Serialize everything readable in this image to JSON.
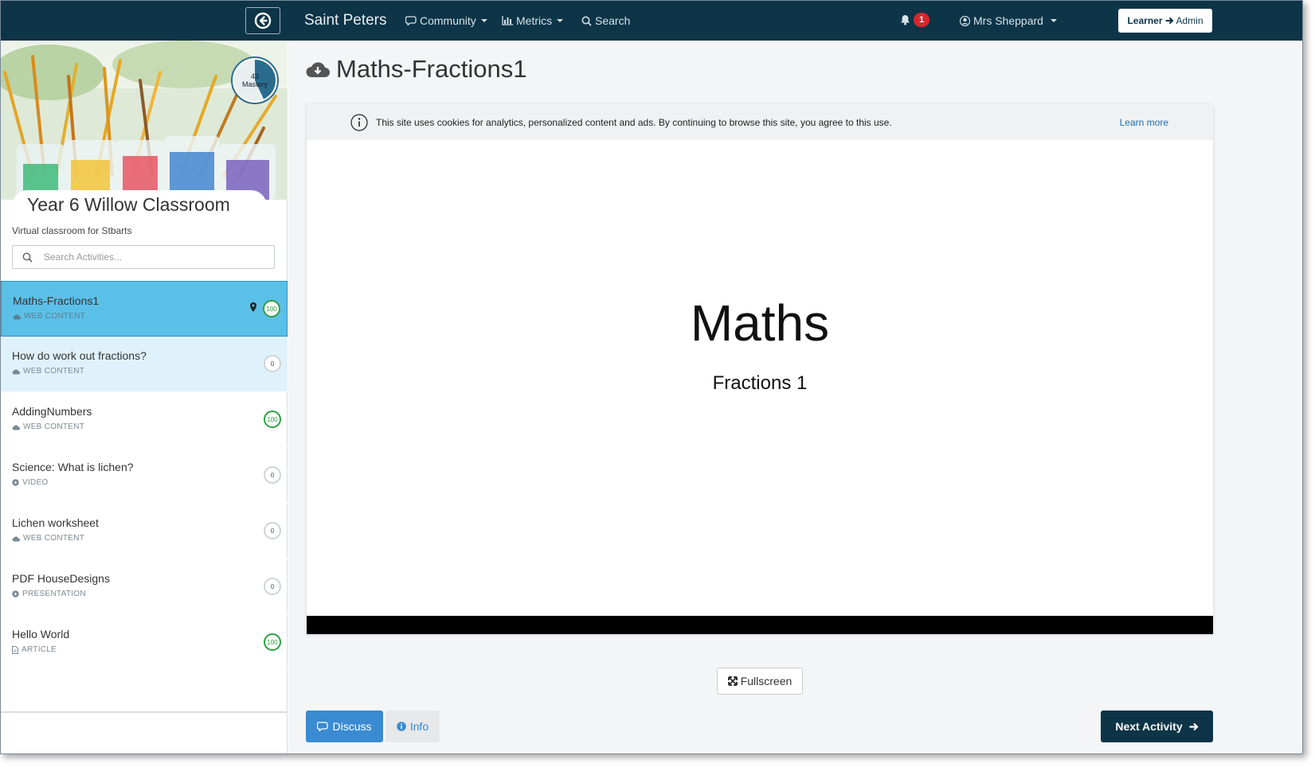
{
  "nav": {
    "brand": "Saint Peters",
    "community": "Community",
    "metrics": "Metrics",
    "search": "Search",
    "notifications_count": "1",
    "user": "Mrs Sheppard",
    "role_from": "Learner",
    "role_to": "Admin"
  },
  "sidebar": {
    "mastery_value": "43",
    "mastery_label": "Mastery",
    "class_title": "Year 6 Willow Classroom",
    "class_subtitle": "Virtual classroom for Stbarts",
    "search_placeholder": "Search Activities...",
    "activities": [
      {
        "title": "Maths-Fractions1",
        "type": "WEB CONTENT",
        "score": "100",
        "icon": "cloud-icon"
      },
      {
        "title": "How do work out fractions?",
        "type": "WEB CONTENT",
        "score": "0",
        "icon": "cloud-icon"
      },
      {
        "title": "AddingNumbers",
        "type": "WEB CONTENT",
        "score": "100",
        "icon": "cloud-icon"
      },
      {
        "title": "Science: What is lichen?",
        "type": "VIDEO",
        "score": "0",
        "icon": "play-icon"
      },
      {
        "title": "Lichen worksheet",
        "type": "WEB CONTENT",
        "score": "0",
        "icon": "cloud-icon"
      },
      {
        "title": "PDF HouseDesigns",
        "type": "PRESENTATION",
        "score": "0",
        "icon": "play-icon"
      },
      {
        "title": "Hello World",
        "type": "ARTICLE",
        "score": "100",
        "icon": "document-icon"
      }
    ]
  },
  "main": {
    "page_title": "Maths-Fractions1",
    "cookie_text": "This site uses cookies for analytics, personalized content and ads. By continuing to browse this site, you agree to this use.",
    "cookie_learn_more": "Learn more",
    "slide_title": "Maths",
    "slide_subtitle": "Fractions 1",
    "fullscreen_label": "Fullscreen",
    "discuss_label": "Discuss",
    "info_label": "Info",
    "next_label": "Next Activity"
  },
  "colors": {
    "navbar": "#0d3447",
    "active_item": "#5bc0e8",
    "hover_item": "#dff2fb",
    "primary_button": "#3a8bd1",
    "score_complete": "#2ea043",
    "badge": "#d9262e"
  }
}
